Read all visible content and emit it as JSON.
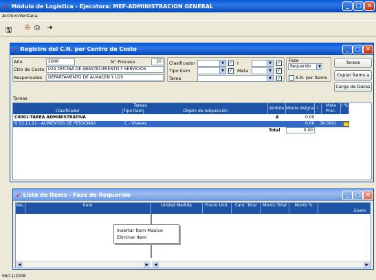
{
  "app": {
    "title": "Módulo de Logística - Ejecutora: MEF-ADMINISTRACION GENERAL",
    "menu": [
      "Archivo",
      "Ventana"
    ]
  },
  "window": {
    "title": "Registro del C.N. por Centro de Costo",
    "fields": {
      "anio_label": "Año",
      "anio_value": "2006",
      "nro_label": "N° Proceso",
      "nro_value": "20",
      "ccosto_label": "Ctro de Costo",
      "ccosto_value": "024 OFICINA DE ABASTECIMIENTO Y SERVICIOS",
      "resp_label": "Responsable",
      "resp_value": "DEPARTAMENTO DE ALMACEN Y LOS",
      "clasif_label": "Clasificador",
      "tipo_label": "Tipo Item",
      "tarea_label": "Tarea",
      "meta_label": "Meta",
      "i_label": "I",
      "fase_label": "Fase",
      "fase_value": "Requerido",
      "azero_label": "A.R. por Ítems"
    },
    "buttons": {
      "tareas": "Tareas",
      "copiar": "Copiar Ítems a",
      "carga": "Carga de Datos"
    },
    "tabla_label": "Tareas",
    "grid": {
      "group_header": "Tareas",
      "headers": [
        "Clasificador",
        "Tipo Item",
        "Objeto de Adquisición",
        "Ambito",
        "Monto Asignad",
        "I",
        "Meta Proc.",
        "I %"
      ],
      "rows": [
        {
          "clasif": "C0001-TAREA ADMINISTRATIVA",
          "tipo": "",
          "obj": "",
          "ambito": "A",
          "monto": "0.00",
          "meta": ""
        },
        {
          "clasif": "B    53.11.21 - ALIMENTOS DE PERSONAS",
          "tipo": "C - Víveres",
          "obj": "",
          "ambito": "",
          "monto": "0.00",
          "meta": "38.0001"
        }
      ],
      "total_label": "Total",
      "total_value": "0.00"
    }
  },
  "items_window": {
    "title": "Lista de Items - Fase de Requerido",
    "headers": [
      "Sec.",
      "Item",
      "Unidad Medida",
      "Precio Unit.",
      "Cant. Total",
      "Monto Total",
      "Monto %"
    ],
    "sub_header": "Enero",
    "context_menu": [
      "Insertar Item Masivo",
      "Eliminar Item"
    ]
  },
  "status": {
    "text": "06/11/2006"
  },
  "colors": {
    "title_blue": "#0a5ad8",
    "header_blue": "#1d54a8",
    "selection_blue": "#3169c6"
  }
}
